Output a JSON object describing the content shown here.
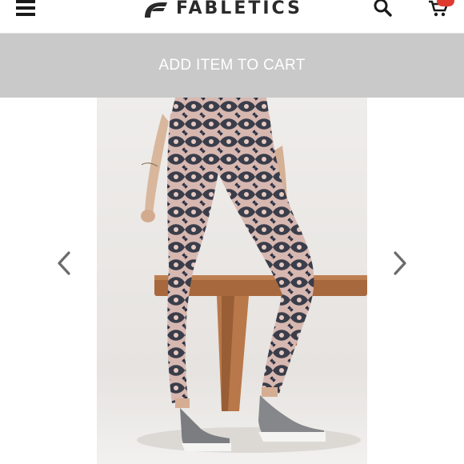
{
  "header": {
    "brand_name": "FABLETICS",
    "menu_icon": "hamburger-menu-icon",
    "search_icon": "search-icon",
    "cart_icon": "shopping-cart-icon",
    "cart_badge_color": "#e03a2f"
  },
  "cart_bar": {
    "label": "ADD ITEM TO CART",
    "background": "#c9c9c9"
  },
  "gallery": {
    "image": "product-photo-leggings",
    "prev_icon": "chevron-left-icon",
    "next_icon": "chevron-right-icon"
  }
}
